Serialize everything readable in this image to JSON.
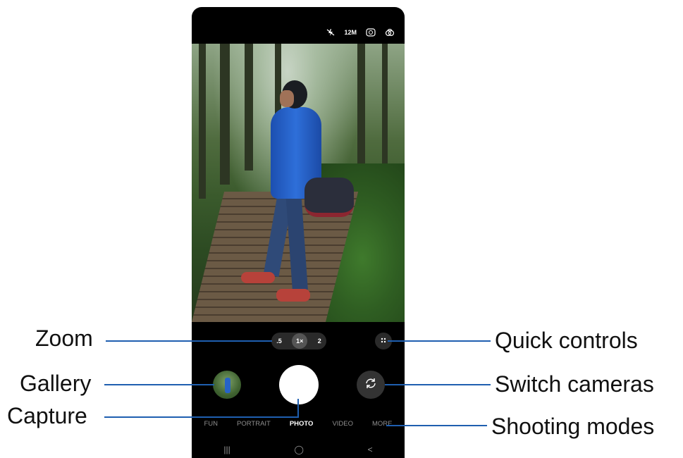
{
  "status_bar": {
    "flash_icon": "flash-off-icon",
    "resolution": "12M",
    "timer_icon": "timer-icon",
    "filter_icon": "filter-icon"
  },
  "zoom": {
    "options": [
      ".5",
      "1×",
      "2"
    ],
    "selected": "1×"
  },
  "modes": [
    "FUN",
    "PORTRAIT",
    "PHOTO",
    "VIDEO",
    "MORE"
  ],
  "selected_mode": "PHOTO",
  "nav_bar": {
    "recent": "|||",
    "home": "◯",
    "back": "<"
  },
  "callouts": {
    "zoom": "Zoom",
    "gallery": "Gallery",
    "capture": "Capture",
    "quick_controls": "Quick controls",
    "switch_cameras": "Switch cameras",
    "shooting_modes": "Shooting modes"
  },
  "colors": {
    "callout_line": "#1f5fb0",
    "phone_body": "#000000"
  }
}
